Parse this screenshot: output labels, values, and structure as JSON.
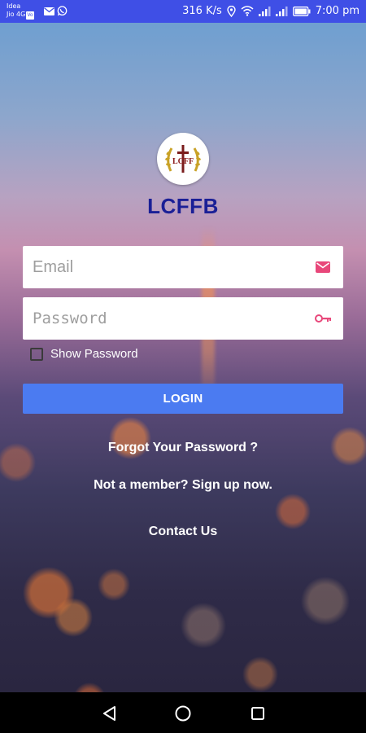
{
  "status_bar": {
    "carrier_line1": "Idea",
    "carrier_line2": "Jio 4G",
    "volte_badge": "Vo",
    "speed": "316 K/s",
    "time": "7:00 pm",
    "background_color": "#3f4fe6",
    "icons": [
      "email-icon",
      "whatsapp-icon",
      "location-icon",
      "wifi-icon",
      "signal-icon",
      "signal-icon",
      "battery-icon"
    ]
  },
  "app": {
    "logo_text": "LCFF",
    "title": "LCFFB"
  },
  "form": {
    "email_placeholder": "Email",
    "email_value": "",
    "password_placeholder": "Password",
    "password_value": "",
    "show_password_label": "Show Password",
    "show_password_checked": false,
    "login_button": "LOGIN"
  },
  "links": {
    "forgot_password": "Forgot Your Password ?",
    "sign_up": "Not a member? Sign up now.",
    "contact_us": "Contact Us"
  },
  "colors": {
    "accent": "#4b7bf1",
    "title": "#1a1f96",
    "field_icon": "#e8477a"
  },
  "nav_bar": {
    "icons": [
      "back-icon",
      "home-icon",
      "recents-icon"
    ]
  }
}
